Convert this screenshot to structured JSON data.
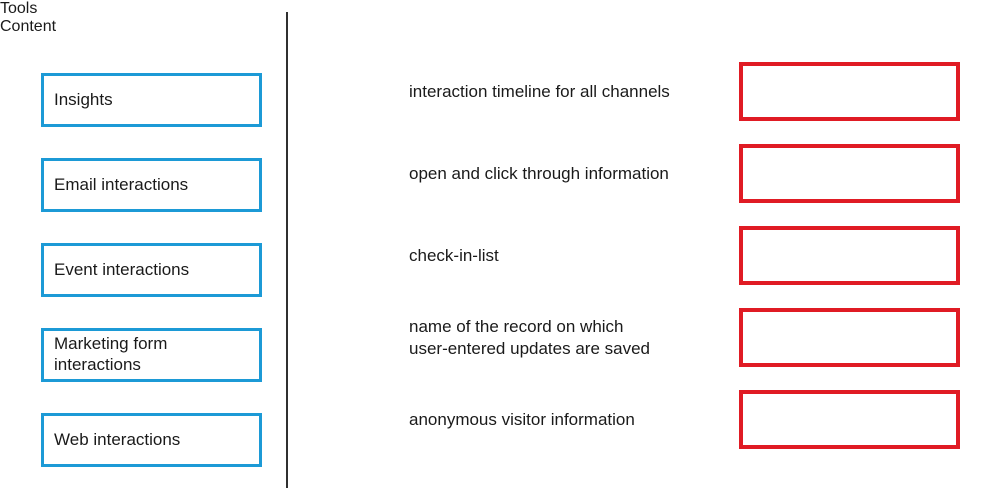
{
  "columns": {
    "tools_heading": "Tools",
    "content_heading": "Content"
  },
  "tools": {
    "items": [
      {
        "label": "Insights"
      },
      {
        "label": "Email interactions"
      },
      {
        "label": "Event interactions"
      },
      {
        "label": "Marketing form\ninteractions"
      },
      {
        "label": "Web interactions"
      }
    ]
  },
  "content": {
    "rows": [
      {
        "label": "interaction timeline for all channels",
        "answer": ""
      },
      {
        "label": "open and click through information",
        "answer": ""
      },
      {
        "label": "check-in-list",
        "answer": ""
      },
      {
        "label": "name of the record on which\nuser-entered updates are saved",
        "answer": ""
      },
      {
        "label": "anonymous visitor information",
        "answer": ""
      }
    ]
  },
  "colors": {
    "tool_border": "#1C9AD6",
    "drop_zone_border": "#E01B24",
    "divider": "#303030",
    "text": "#1A1A1A",
    "background": "#FFFFFF"
  }
}
